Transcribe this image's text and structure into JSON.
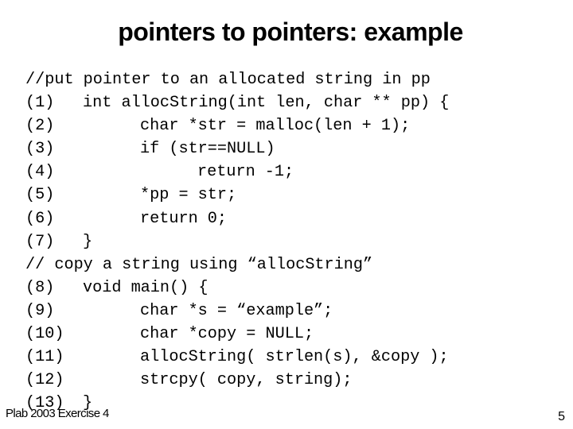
{
  "slide": {
    "title": "pointers to pointers: example",
    "footer_left": "Plab 2003 Exercise 4",
    "page_number": "5"
  },
  "code_lines": [
    {
      "num": "",
      "indent": "comment",
      "text": "//put pointer to an allocated string in pp"
    },
    {
      "num": "(1)",
      "indent": 0,
      "text": "int allocString(int len, char ** pp) {"
    },
    {
      "num": "(2)",
      "indent": 1,
      "text": "char *str = malloc(len + 1);"
    },
    {
      "num": "(3)",
      "indent": 1,
      "text": "if (str==NULL)"
    },
    {
      "num": "(4)",
      "indent": 2,
      "text": "return -1;"
    },
    {
      "num": "(5)",
      "indent": 1,
      "text": "*pp = str;"
    },
    {
      "num": "(6)",
      "indent": 1,
      "text": "return 0;"
    },
    {
      "num": "(7)",
      "indent": 0,
      "text": "}"
    },
    {
      "num": "",
      "indent": "comment",
      "text": "// copy a string using “allocString”"
    },
    {
      "num": "(8)",
      "indent": 0,
      "text": "void main() {"
    },
    {
      "num": "(9)",
      "indent": 1,
      "text": "char *s = “example”;"
    },
    {
      "num": "(10)",
      "indent": 1,
      "text": "char *copy = NULL;"
    },
    {
      "num": "(11)",
      "indent": 1,
      "text": "allocString( strlen(s), &copy );"
    },
    {
      "num": "(12)",
      "indent": 1,
      "text": "strcpy( copy, string);"
    },
    {
      "num": "(13)",
      "indent": 0,
      "text": "}"
    }
  ]
}
